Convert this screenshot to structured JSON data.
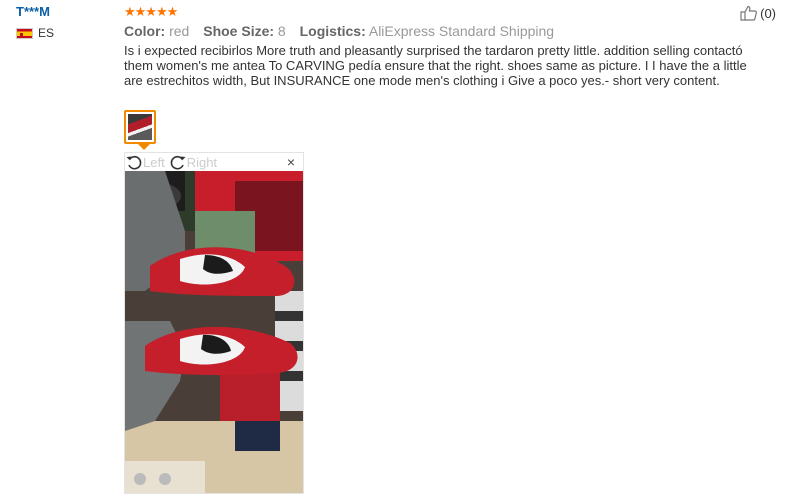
{
  "buyer": {
    "name": "T***M",
    "country": "ES"
  },
  "rating": {
    "stars": "★★★★★",
    "count": 5
  },
  "meta": {
    "color_label": "Color:",
    "color_value": "red",
    "size_label": "Shoe Size:",
    "size_value": "8",
    "logistics_label": "Logistics:",
    "logistics_value": "AliExpress Standard Shipping"
  },
  "feedback": {
    "text": "Is i expected recibirlos More truth and pleasantly surprised the tardaron pretty little. addition selling contactó them women's me antea To CARVING pedía ensure that the right. shoes same as picture. I I have the a little are estrechitos width, But INSURANCE one mode men's clothing i Give a poco yes.- short very content."
  },
  "helpful": {
    "count": "(0)",
    "icon": "thumbs-up-icon"
  },
  "viewer": {
    "rotate_left": "Left",
    "rotate_right": "Right",
    "close": "×"
  },
  "colors": {
    "buyer_name": "#0b5fa5",
    "stars": "#ff7300",
    "thumb_border": "#f08a00",
    "meta_label": "#666666",
    "meta_value": "#999999"
  }
}
